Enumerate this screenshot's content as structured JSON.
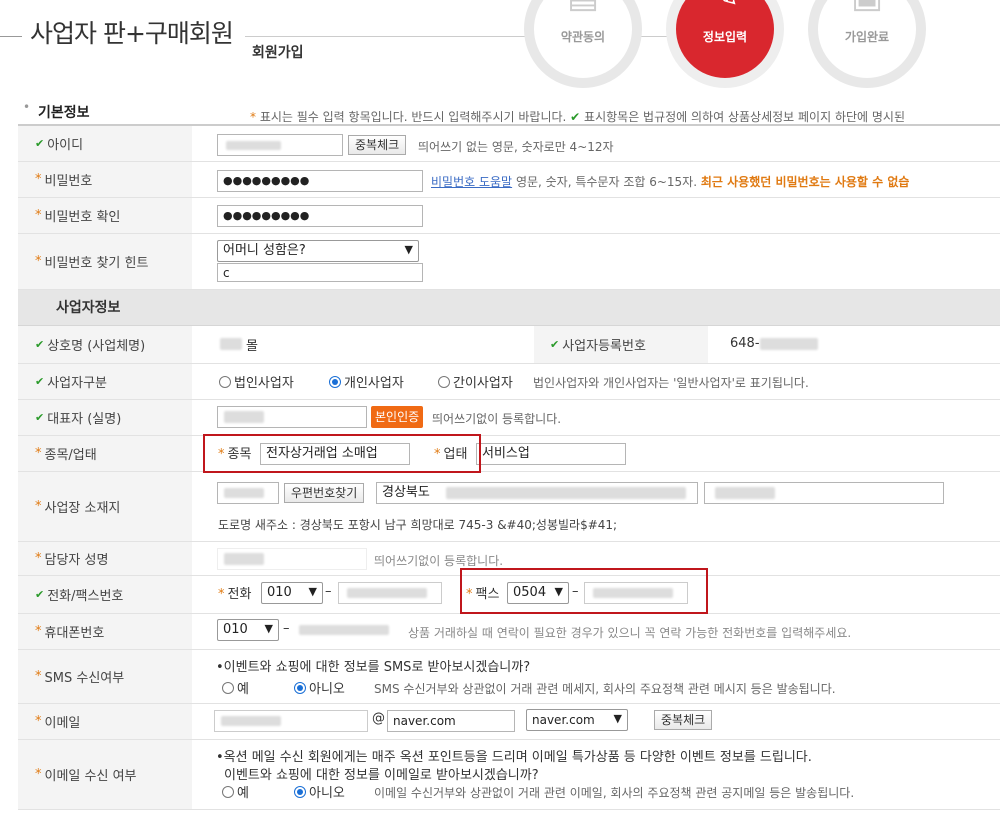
{
  "header": {
    "title": "사업자 판+구매회원",
    "subtitle": "회원가입",
    "steps": [
      {
        "label": "약관동의",
        "icon": "document-icon",
        "active": false
      },
      {
        "label": "정보입력",
        "icon": "pencil-icon",
        "active": true
      },
      {
        "label": "가입완료",
        "icon": "id-card-icon",
        "active": false
      }
    ]
  },
  "basic": {
    "section_title": "기본정보",
    "notice_req_mark": "*",
    "notice_req_text": " 표시는 필수 입력 항목입니다. 반드시 입력해주시기 바랍니다. ",
    "notice_chk_mark": "✔",
    "notice_chk_text": " 표시항목은 법규정에 의하여 상품상세정보 페이지 하단에 명시된",
    "id": {
      "label": "아이디",
      "button": "중복체크",
      "hint": "띄어쓰기 없는 영문, 숫자로만 4~12자"
    },
    "password": {
      "label": "비밀번호",
      "value": "●●●●●●●●●",
      "help_link": "비밀번호 도움말",
      "hint": "영문, 숫자, 특수문자 조합 6~15자.",
      "warning": "최근 사용했던 비밀번호는 사용할 수 없습"
    },
    "password_confirm": {
      "label": "비밀번호 확인",
      "value": "●●●●●●●●●"
    },
    "hint_q": {
      "label": "비밀번호 찾기 힌트",
      "selected": "어머니 성함은?",
      "answer": "c"
    }
  },
  "biz": {
    "section_title": "사업자정보",
    "company": {
      "label": "상호명 (사업체명)",
      "value_suffix": "몰",
      "reg_label": "사업자등록번호",
      "reg_value": "648-"
    },
    "biz_type": {
      "label": "사업자구분",
      "options": [
        "법인사업자",
        "개인사업자",
        "간이사업자"
      ],
      "selected": "개인사업자",
      "note": "법인사업자와 개인사업자는 '일반사업자'로 표기됩니다."
    },
    "ceo": {
      "label": "대표자 (실명)",
      "button": "본인인증",
      "hint": "띄어쓰기없이 등록합니다."
    },
    "category": {
      "label": "종목/업태",
      "item_label": "종목",
      "item_value": "전자상거래업 소매업",
      "type_label": "업태",
      "type_value": "서비스업"
    },
    "address": {
      "label": "사업장 소재지",
      "button": "우편번호찾기",
      "addr1": "경상북도 ",
      "road_addr": "도로명 새주소 : 경상북도 포항시 남구 희망대로 745-3 &#40;성봉빌라$#41;"
    },
    "manager": {
      "label": "담당자 성명",
      "hint": "띄어쓰기없이 등록합니다."
    },
    "phone_fax": {
      "label": "전화/팩스번호",
      "phone_label": "전화",
      "phone_prefix": "010",
      "fax_label": "팩스",
      "fax_prefix": "0504",
      "dash": "–"
    },
    "mobile": {
      "label": "휴대폰번호",
      "prefix": "010",
      "dash": "–",
      "hint": "상품 거래하실 때 연락이 필요한 경우가 있으니 꼭 연락 가능한 전화번호를 입력해주세요."
    },
    "sms": {
      "label": "SMS 수신여부",
      "question": "•이벤트와 쇼핑에 대한 정보를 SMS로 받아보시겠습니까?",
      "yes": "예",
      "no": "아니오",
      "selected": "아니오",
      "note": "SMS 수신거부와 상관없이 거래 관련 메세지, 회사의 주요정책 관련 메시지 등은 발송됩니다."
    },
    "email": {
      "label": "이메일",
      "at": "@",
      "domain": "naver.com",
      "domain_select": "naver.com",
      "button": "중복체크"
    },
    "email_recv": {
      "label": "이메일 수신 여부",
      "line1": "•옥션 메일 수신 회원에게는 매주 옥션 포인트등을 드리며 이메일 특가상품 등 다양한 이벤트 정보를 드립니다.",
      "line2": "이벤트와 쇼핑에 대한 정보를 이메일로 받아보시겠습니까?",
      "yes": "예",
      "no": "아니오",
      "selected": "아니오",
      "note": "이메일 수신거부와 상관없이 거래 관련 이메일, 회사의 주요정책 관련 공지메일 등은 발송됩니다."
    }
  },
  "marks": {
    "req": "*",
    "chk": "✔"
  },
  "colors": {
    "accent": "#d9272e",
    "required": "#e07a12",
    "check": "#2a9a2a",
    "highlight_box": "#c0161c"
  }
}
